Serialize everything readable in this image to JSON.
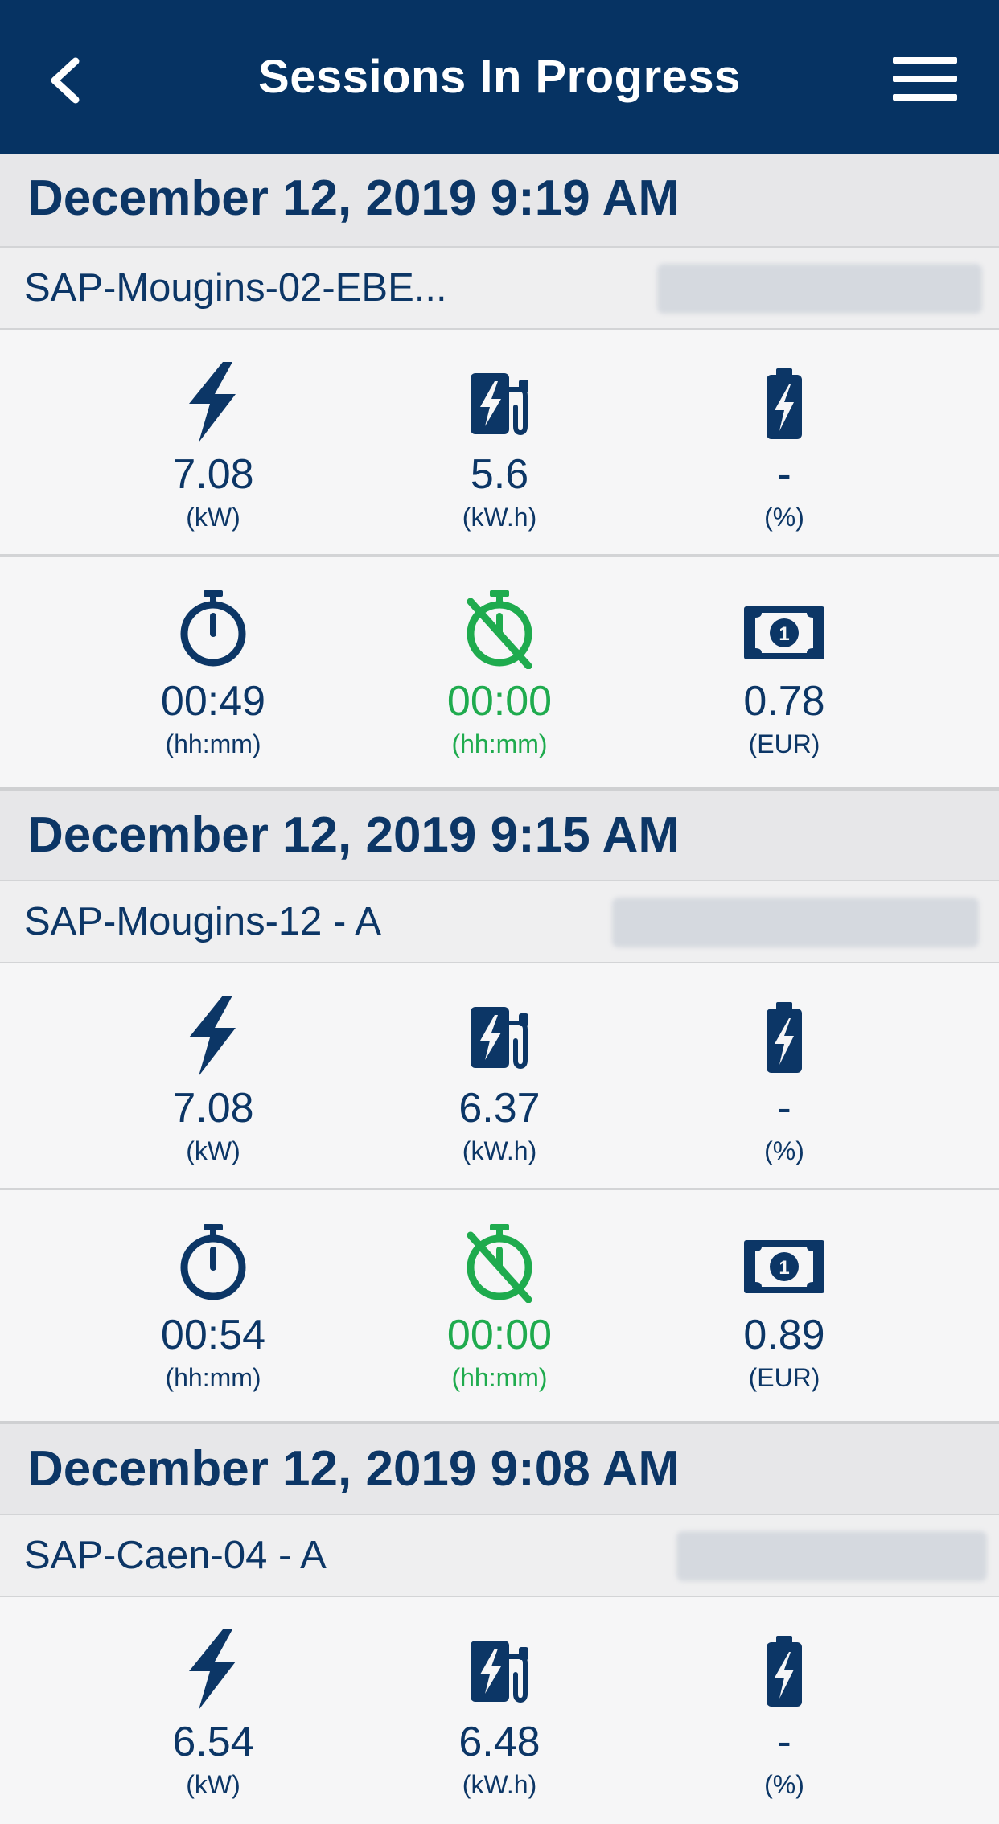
{
  "header": {
    "title": "Sessions In Progress",
    "background_color": "#063363",
    "back_icon": "chevron-left-icon",
    "menu_icon": "hamburger-menu-icon"
  },
  "colors": {
    "primary": "#0c3666",
    "accent_green": "#1fab4e"
  },
  "sessions": [
    {
      "date": "December 12, 2019 9:19 AM",
      "station": "SAP-Mougins-02-EBE...",
      "power": {
        "value": "7.08",
        "unit": "(kW)"
      },
      "energy": {
        "value": "5.6",
        "unit": "(kW.h)"
      },
      "battery": {
        "value": "-",
        "unit": "(%)"
      },
      "duration": {
        "value": "00:49",
        "unit": "(hh:mm)"
      },
      "idle": {
        "value": "00:00",
        "unit": "(hh:mm)"
      },
      "price": {
        "value": "0.78",
        "unit": "(EUR)"
      }
    },
    {
      "date": "December 12, 2019 9:15 AM",
      "station": "SAP-Mougins-12 - A",
      "power": {
        "value": "7.08",
        "unit": "(kW)"
      },
      "energy": {
        "value": "6.37",
        "unit": "(kW.h)"
      },
      "battery": {
        "value": "-",
        "unit": "(%)"
      },
      "duration": {
        "value": "00:54",
        "unit": "(hh:mm)"
      },
      "idle": {
        "value": "00:00",
        "unit": "(hh:mm)"
      },
      "price": {
        "value": "0.89",
        "unit": "(EUR)"
      }
    },
    {
      "date": "December 12, 2019 9:08 AM",
      "station": "SAP-Caen-04 - A",
      "power": {
        "value": "6.54",
        "unit": "(kW)"
      },
      "energy": {
        "value": "6.48",
        "unit": "(kW.h)"
      },
      "battery": {
        "value": "-",
        "unit": "(%)"
      }
    }
  ]
}
